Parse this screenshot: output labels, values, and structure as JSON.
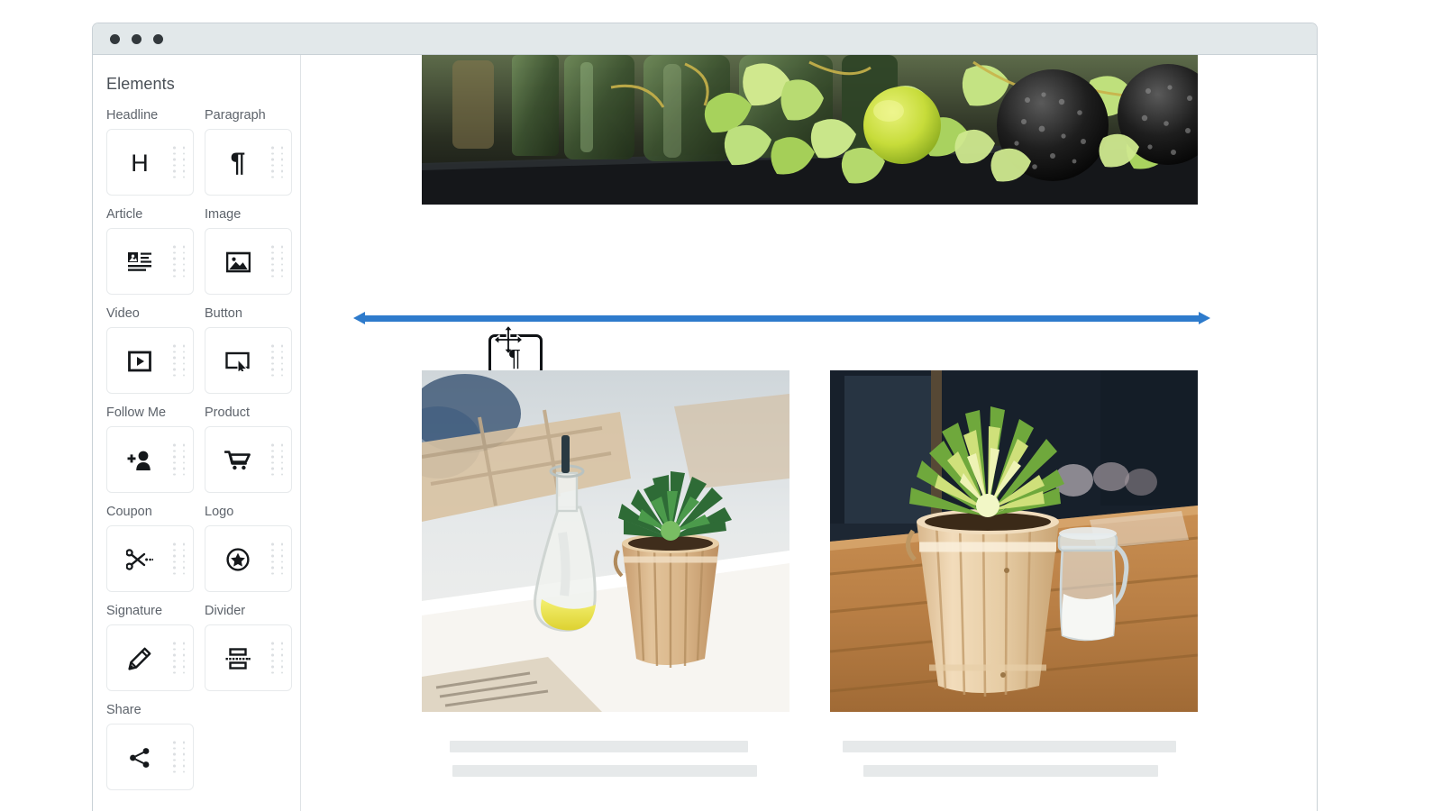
{
  "window": {
    "titlebar": {
      "dots": [
        "close-dot",
        "minimize-dot",
        "maximize-dot"
      ]
    }
  },
  "sidebar": {
    "title": "Elements",
    "items": [
      {
        "label": "Headline",
        "icon": "headline-icon"
      },
      {
        "label": "Paragraph",
        "icon": "paragraph-icon"
      },
      {
        "label": "Article",
        "icon": "article-icon"
      },
      {
        "label": "Image",
        "icon": "image-icon"
      },
      {
        "label": "Video",
        "icon": "video-icon"
      },
      {
        "label": "Button",
        "icon": "button-icon"
      },
      {
        "label": "Follow Me",
        "icon": "follow-me-icon"
      },
      {
        "label": "Product",
        "icon": "product-cart-icon"
      },
      {
        "label": "Coupon",
        "icon": "coupon-scissors-icon"
      },
      {
        "label": "Logo",
        "icon": "logo-star-icon"
      },
      {
        "label": "Signature",
        "icon": "signature-pen-icon"
      },
      {
        "label": "Divider",
        "icon": "divider-icon"
      },
      {
        "label": "Share",
        "icon": "share-icon"
      }
    ]
  },
  "canvas": {
    "hero": {
      "alt": "Green ivy leaves, glass vases, a lime and dark textured ornaments on a dark table"
    },
    "drop_indicator": {
      "color": "#2e7bcc",
      "label": "paragraph-drop-position"
    },
    "drag_ghost": {
      "glyph": "¶",
      "element_type": "Paragraph"
    },
    "products": [
      {
        "alt": "Glass oil bottle with yellow oil beside a green succulent in a wooden bucket on a white table"
      },
      {
        "alt": "Green succulent in a wooden bucket next to a glass jar with white contents on a wooden table"
      }
    ]
  },
  "colors": {
    "accent_blue": "#2e7bcc",
    "titlebar": "#e2e8ea",
    "window_border": "#c9d1d6",
    "card_border": "#e7eaec",
    "label_text": "#5d636b",
    "heading_text": "#4a5057",
    "skeleton": "#e6e9ea"
  }
}
